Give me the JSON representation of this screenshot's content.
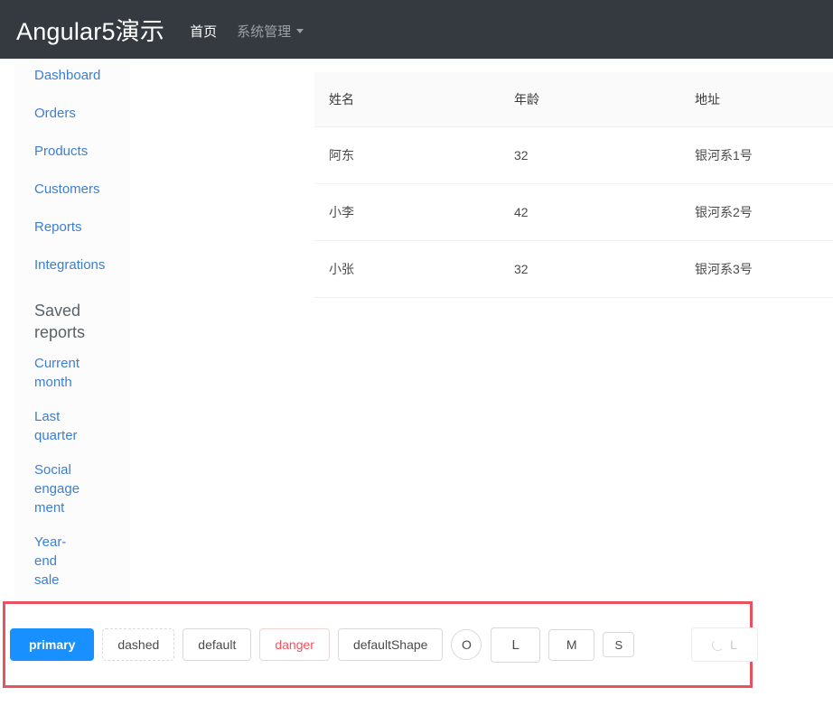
{
  "navbar": {
    "brand": "Angular5演示",
    "links": [
      {
        "label": "首页",
        "active": true
      },
      {
        "label": "系统管理",
        "active": false,
        "has_caret": true
      }
    ],
    "background_color": "#343a40"
  },
  "sidebar": {
    "primary_items": [
      {
        "label": "Dashboard"
      },
      {
        "label": "Orders"
      },
      {
        "label": "Products"
      },
      {
        "label": "Customers"
      },
      {
        "label": "Reports"
      },
      {
        "label": "Integrations"
      }
    ],
    "saved_heading": "Saved reports",
    "saved_items": [
      {
        "label": "Current month"
      },
      {
        "label": "Last quarter"
      },
      {
        "label": "Social engagement"
      },
      {
        "label": "Year-end sale"
      }
    ],
    "link_color": "#3c7fd0"
  },
  "table": {
    "columns": [
      "姓名",
      "年龄",
      "地址"
    ],
    "rows": [
      {
        "name": "阿东",
        "age": "32",
        "address": "银河系1号"
      },
      {
        "name": "小李",
        "age": "42",
        "address": "银河系2号"
      },
      {
        "name": "小张",
        "age": "32",
        "address": "银河系3号"
      }
    ],
    "header_background": "#fafafa"
  },
  "button_strip": {
    "highlight_color": "#e8525f",
    "buttons": [
      {
        "label": "primary",
        "variant": "primary"
      },
      {
        "label": "dashed",
        "variant": "dashed"
      },
      {
        "label": "default",
        "variant": "default"
      },
      {
        "label": "danger",
        "variant": "danger"
      },
      {
        "label": "defaultShape",
        "variant": "default"
      },
      {
        "label": "O",
        "variant": "circle"
      },
      {
        "label": "L",
        "variant": "large"
      },
      {
        "label": "M",
        "variant": "medium"
      },
      {
        "label": "S",
        "variant": "small"
      },
      {
        "label": "L",
        "variant": "loading"
      }
    ],
    "primary_color": "#1890ff",
    "danger_color": "#f5515f"
  }
}
